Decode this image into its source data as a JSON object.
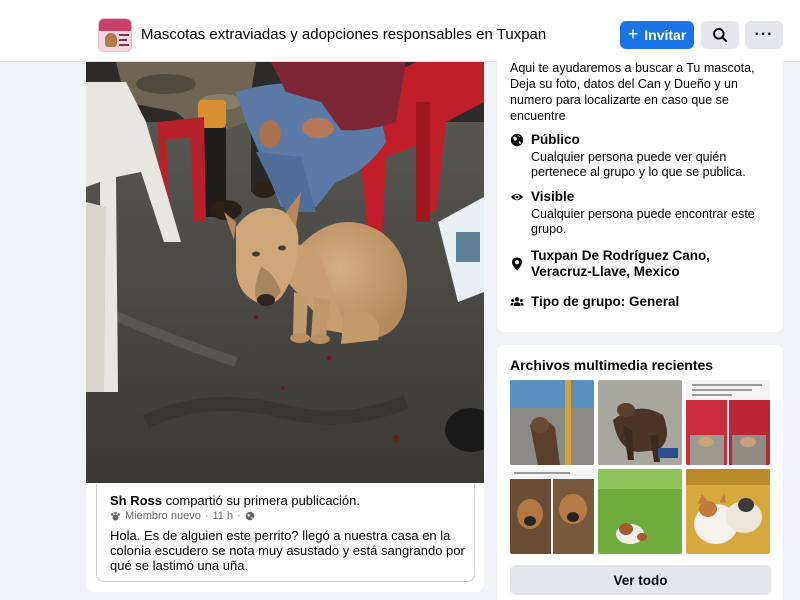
{
  "header": {
    "group_name": "Mascotas extraviadas y adopciones responsables en Tuxpan",
    "invite_label": "Invitar",
    "more_label": "···"
  },
  "post": {
    "author": "Sh Ross",
    "action": "compartió su primera publicación.",
    "badge": "Miembro nuevo",
    "separator": "·",
    "time": "11 h",
    "text": "Hola. Es de alguien este perrito? llegó a nuestra casa en la colonia escudero se nota muy asustado y está sangrando por qué se lastimó una uña."
  },
  "about": {
    "description": "Aqui te ayudaremos a buscar a Tu mascota, Deja su foto, datos del Can y Dueño y un numero para localizarte en caso que se encuentre",
    "privacy_title": "Público",
    "privacy_desc": "Cualquier persona puede ver quién pertenece al grupo y lo que se publica.",
    "visibility_title": "Visible",
    "visibility_desc": "Cualquier persona puede encontrar este grupo.",
    "location": "Tuxpan De Rodríguez Cano, Veracruz-Llave, Mexico",
    "group_type": "Tipo de grupo: General"
  },
  "media": {
    "title": "Archivos multimedia recientes",
    "see_all_label": "Ver todo"
  },
  "icons": {
    "search": "search-icon",
    "more": "more-icon",
    "globe": "globe-icon",
    "eye": "eye-icon",
    "location": "location-pin-icon",
    "group": "group-people-icon",
    "member_badge": "new-member-icon",
    "audience": "globe-audience-icon"
  },
  "colors": {
    "primary": "#1b74e4",
    "page_bg": "#f0f2f5",
    "card_bg": "#ffffff",
    "button_grey": "#e4e6eb",
    "secondary_text": "#65676b"
  }
}
